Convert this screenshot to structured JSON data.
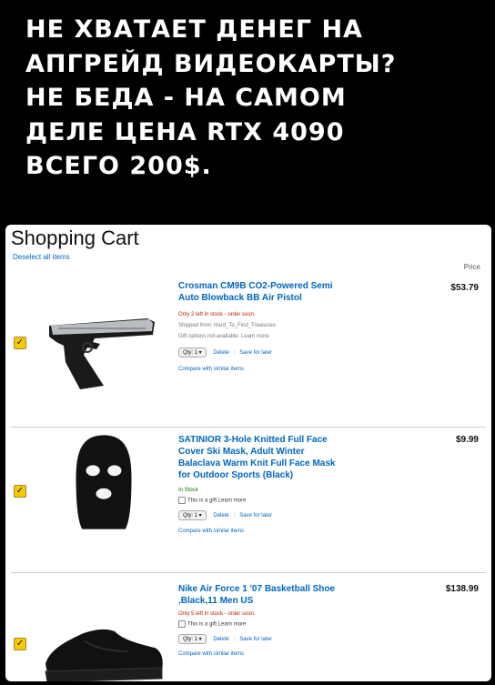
{
  "caption": {
    "lines": [
      "НЕ ХВАТАЕТ ДЕНЕГ НА",
      "АПГРЕЙД ВИДЕОКАРТЫ?",
      "НЕ БЕДА - НА САМОМ",
      "ДЕЛЕ ЦЕНА RTX 4090",
      "ВСЕГО 200$."
    ]
  },
  "cart": {
    "title": "Shopping Cart",
    "deselect": "Deselect all items",
    "price_header": "Price",
    "items": [
      {
        "title_lines": [
          "Crosman CM9B CO2-Powered Semi",
          "Auto Blowback BB Air Pistol"
        ],
        "price": "$53.79",
        "stock": "Only 2 left in stock - order soon.",
        "shipped": "Shipped from: Hard_To_Find_Treasures",
        "gift": "Gift options not available. Learn more",
        "qty": "Qty: 1",
        "delete": "Delete",
        "save": "Save for later",
        "compare": "Compare with similar items",
        "checked": "✓"
      },
      {
        "title_lines": [
          "SATINIOR 3-Hole Knitted Full Face",
          "Cover Ski Mask, Adult Winter",
          "Balaclava Warm Knit Full Face Mask",
          "for Outdoor Sports (Black)"
        ],
        "price": "$9.99",
        "stock": "In Stock",
        "gift": "This is a gift Learn more",
        "qty": "Qty: 1",
        "delete": "Delete",
        "save": "Save for later",
        "compare": "Compare with similar items",
        "checked": "✓"
      },
      {
        "title_lines": [
          "Nike Air Force 1 '07 Basketball Shoe",
          ",Black,11 Men US"
        ],
        "price": "$138.99",
        "stock": "Only 5 left in stock - order soon.",
        "gift": "This is a gift Learn more",
        "qty": "Qty: 1",
        "delete": "Delete",
        "save": "Save for later",
        "compare": "Compare with similar items",
        "checked": "✓"
      }
    ]
  },
  "colors": {
    "link": "#0066c0",
    "checkbox": "#f7ca00",
    "in_stock": "#007600"
  },
  "icons": {
    "item_1": "pistol-icon",
    "item_2": "balaclava-icon",
    "item_3": "sneaker-icon",
    "checkbox": "checkbox-icon"
  }
}
